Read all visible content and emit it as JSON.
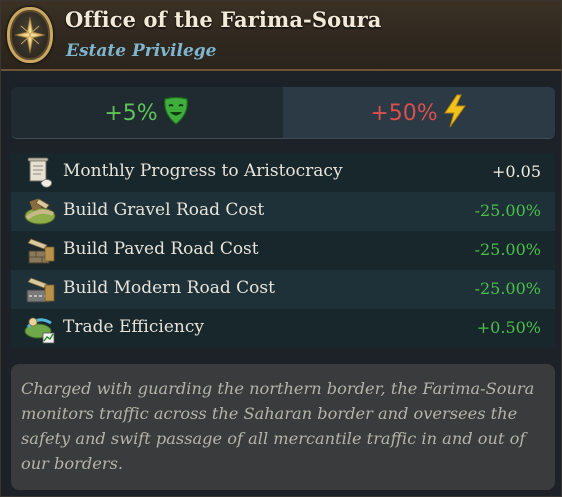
{
  "header": {
    "title": "Office of the Farima-Soura",
    "subtitle": "Estate Privilege",
    "emblem_icon": "compass-star-icon"
  },
  "stats": [
    {
      "value": "+5%",
      "icon": "happy-mask-icon",
      "color": "#5ec45a"
    },
    {
      "value": "+50%",
      "icon": "lightning-icon",
      "color": "#d9504f"
    }
  ],
  "modifiers": [
    {
      "label": "Monthly Progress to Aristocracy",
      "value": "+0.05",
      "icon": "scroll-icon",
      "value_color": "#f0ece0"
    },
    {
      "label": "Build Gravel Road Cost",
      "value": "-25.00%",
      "icon": "gravel-road-icon",
      "value_color": "#49c048"
    },
    {
      "label": "Build Paved Road Cost",
      "value": "-25.00%",
      "icon": "paved-road-icon",
      "value_color": "#49c048"
    },
    {
      "label": "Build Modern Road Cost",
      "value": "-25.00%",
      "icon": "modern-road-icon",
      "value_color": "#49c048"
    },
    {
      "label": "Trade Efficiency",
      "value": "+0.50%",
      "icon": "trade-efficiency-icon",
      "value_color": "#49c048"
    }
  ],
  "description": "Charged with guarding the northern border, the Farima-Soura monitors traffic across the Saharan border and oversees the safety and swift passage of all mercantile traffic in and out of our borders."
}
